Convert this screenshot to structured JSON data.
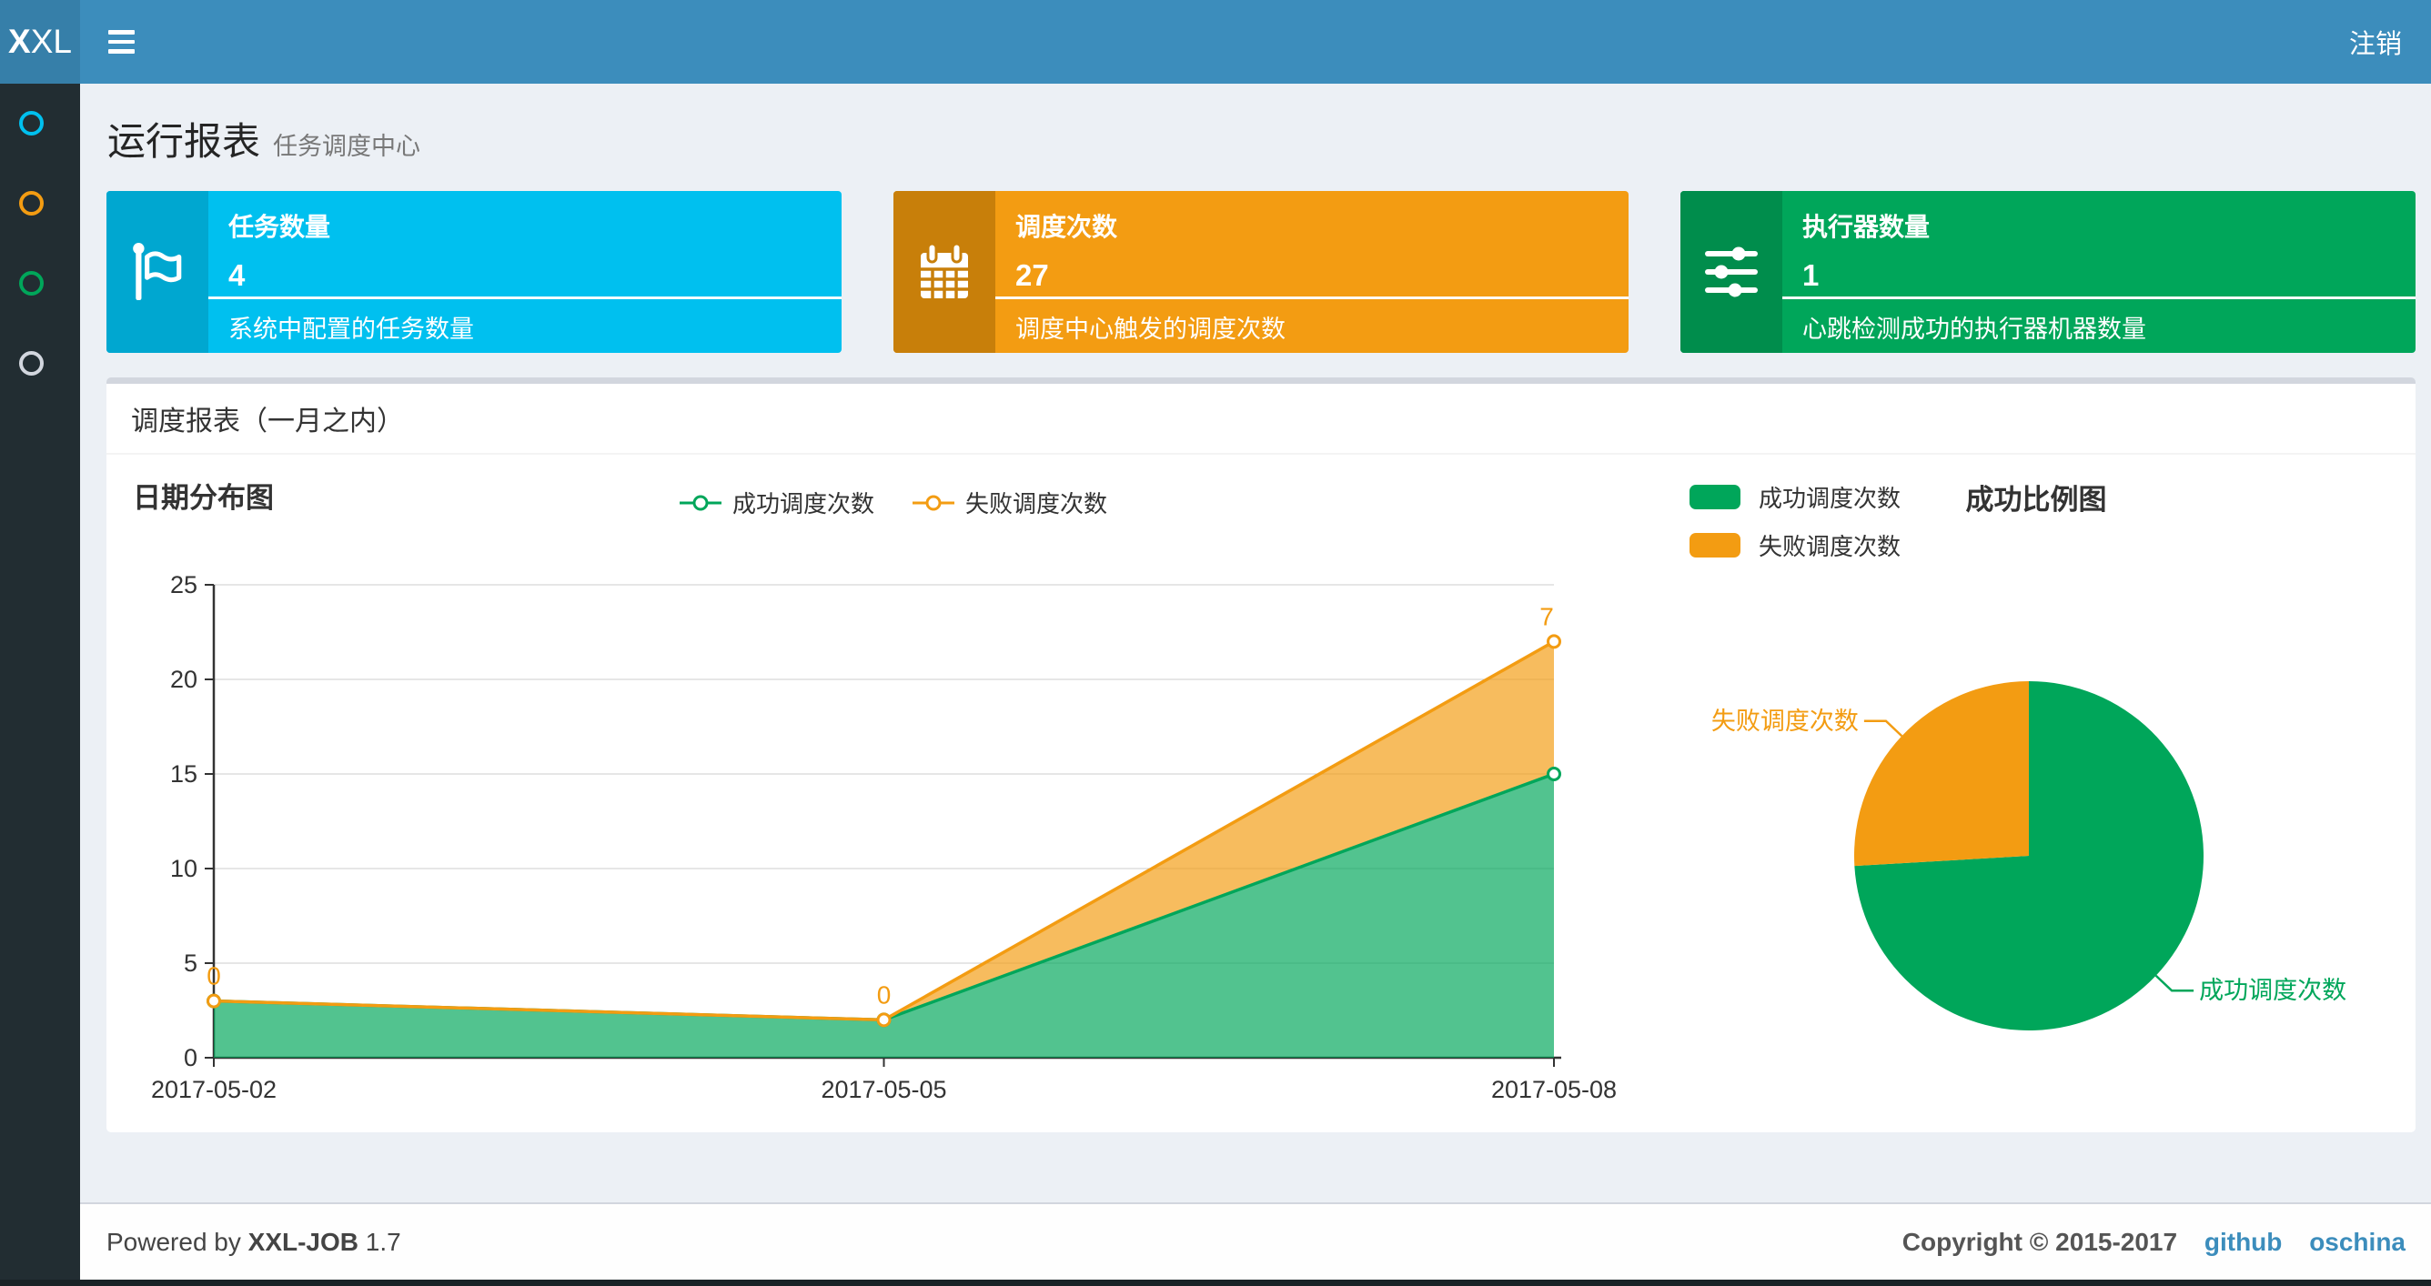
{
  "navbar": {
    "logo_bold": "X",
    "logo_rest": "XL",
    "logout_label": "注销"
  },
  "sidebar": {
    "items": [
      {
        "icon": "circle-o-icon",
        "color": "#00c0ef"
      },
      {
        "icon": "circle-o-icon",
        "color": "#f39c12"
      },
      {
        "icon": "circle-o-icon",
        "color": "#00a65a"
      },
      {
        "icon": "circle-o-icon",
        "color": "#d2d6de"
      }
    ]
  },
  "page_header": {
    "title": "运行报表",
    "subtitle": "任务调度中心"
  },
  "stat_cards": [
    {
      "label": "任务数量",
      "value": "4",
      "description": "系统中配置的任务数量",
      "icon": "flag-icon",
      "color": "#00c0ef",
      "icon_bg": "#00a7d0"
    },
    {
      "label": "调度次数",
      "value": "27",
      "description": "调度中心触发的调度次数",
      "icon": "calendar-icon",
      "color": "#f39c12",
      "icon_bg": "#c87f0a"
    },
    {
      "label": "执行器数量",
      "value": "1",
      "description": "心跳检测成功的执行器机器数量",
      "icon": "sliders-icon",
      "color": "#00a65a",
      "icon_bg": "#008d4c"
    }
  ],
  "panel": {
    "title": "调度报表（一月之内）"
  },
  "chart_data": [
    {
      "type": "area",
      "title": "日期分布图",
      "x": [
        "2017-05-02",
        "2017-05-05",
        "2017-05-08"
      ],
      "series": [
        {
          "name": "成功调度次数",
          "values": [
            3,
            2,
            15
          ],
          "color": "#00a65a"
        },
        {
          "name": "失败调度次数",
          "values": [
            0,
            0,
            7
          ],
          "color": "#f39c12"
        }
      ],
      "stacked": true,
      "point_labels_series": "失败调度次数",
      "point_labels": [
        0,
        0,
        7
      ],
      "ylim": [
        0,
        25
      ],
      "ytick_step": 5,
      "grid": true,
      "legend_position": "top-center"
    },
    {
      "type": "pie",
      "title": "成功比例图",
      "labels": [
        "成功调度次数",
        "失败调度次数"
      ],
      "values": [
        20,
        7
      ],
      "colors": [
        "#00a65a",
        "#f39c12"
      ],
      "legend_position": "top-left"
    }
  ],
  "footer": {
    "powered_prefix": "Powered by",
    "product": "XXL-JOB",
    "version": "1.7",
    "copyright": "Copyright © 2015-2017",
    "links": [
      {
        "label": "github"
      },
      {
        "label": "oschina"
      }
    ]
  }
}
